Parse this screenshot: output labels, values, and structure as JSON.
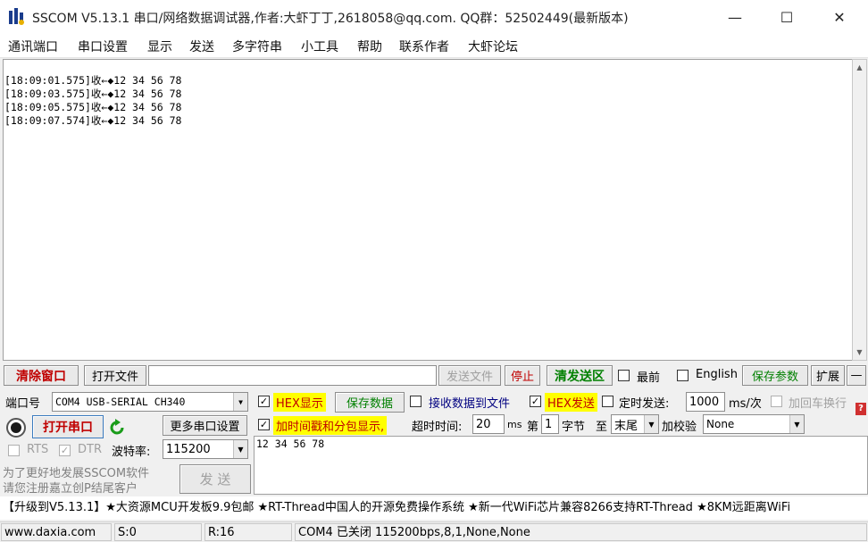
{
  "window": {
    "title": "SSCOM V5.13.1 串口/网络数据调试器,作者:大虾丁丁,2618058@qq.com. QQ群：52502449(最新版本)",
    "minimize": "—",
    "maximize": "☐",
    "close": "✕"
  },
  "menu": [
    "通讯端口",
    "串口设置",
    "显示",
    "发送",
    "多字符串",
    "小工具",
    "帮助",
    "联系作者",
    "大虾论坛"
  ],
  "receive": {
    "lines": [
      "[18:09:01.575]收←◆12 34 56 78",
      "[18:09:03.575]收←◆12 34 56 78",
      "[18:09:05.575]收←◆12 34 56 78",
      "[18:09:07.574]收←◆12 34 56 78"
    ]
  },
  "toolbar": {
    "clear_window": "清除窗口",
    "open_file": "打开文件",
    "file_path": "",
    "send_file": "发送文件",
    "stop": "停止",
    "clear_send": "清发送区",
    "topmost": "最前",
    "english": "English",
    "save_params": "保存参数",
    "expand": "扩展",
    "collapse": "—"
  },
  "port": {
    "port_label": "端口号",
    "port_value": "COM4 USB-SERIAL CH340",
    "open_port": "打开串口",
    "more_settings": "更多串口设置",
    "rts": "RTS",
    "dtr": "DTR",
    "baud_label": "波特率:",
    "baud_value": "115200"
  },
  "options": {
    "hex_display": "HEX显示",
    "save_data": "保存数据",
    "recv_to_file": "接收数据到文件",
    "hex_send": "HEX发送",
    "timed_send": "定时发送:",
    "interval": "1000",
    "interval_unit": "ms/次",
    "append_newline": "加回车换行",
    "timestamp": "加时间戳和分包显示,",
    "timeout_label": "超时时间:",
    "timeout_value": "20",
    "timeout_unit": "ms",
    "nth": "第",
    "byte_index": "1",
    "byte_unit": "字节",
    "to": "至",
    "end_value": "末尾",
    "checksum_label": "加校验",
    "checksum_value": "None"
  },
  "promo": {
    "line1": "为了更好地发展SSCOM软件",
    "line2": "请您注册嘉立创P结尾客户"
  },
  "send": {
    "button": "发  送",
    "content": "12 34 56 78"
  },
  "ticker": "【升级到V5.13.1】★大资源MCU开发板9.9包邮 ★RT-Thread中国人的开源免费操作系统 ★新一代WiFi芯片兼容8266支持RT-Thread ★8KM远距离WiFi",
  "status": {
    "site": "www.daxia.com",
    "sent": "S:0",
    "received": "R:16",
    "port_state": "COM4 已关闭  115200bps,8,1,None,None"
  },
  "colors": {
    "accent_red": "#c00000",
    "highlight_yellow": "#ffff00",
    "green_text": "#008000"
  }
}
